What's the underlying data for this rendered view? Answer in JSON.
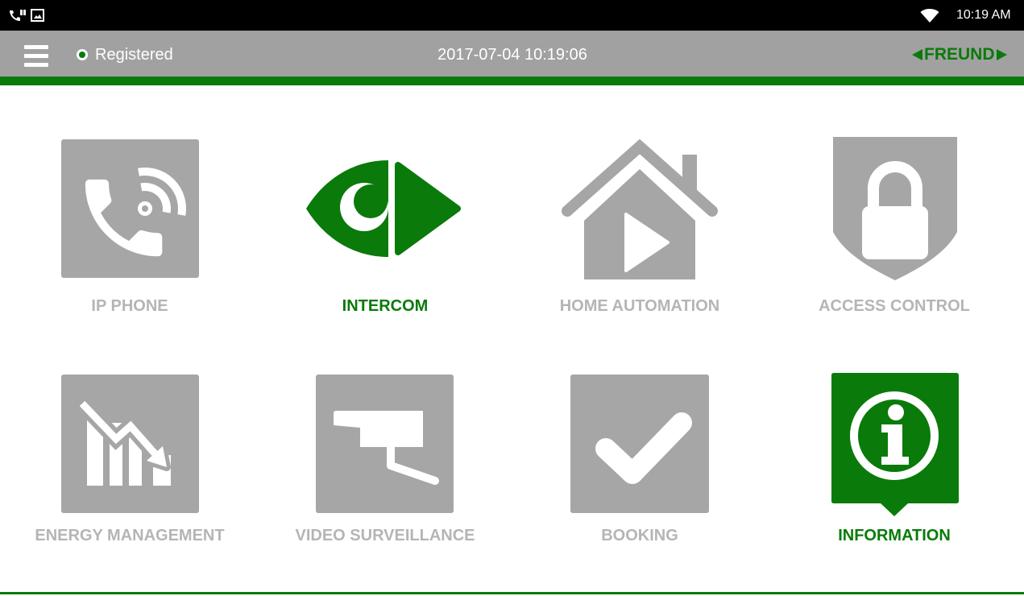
{
  "status_bar": {
    "left_icons": [
      "phone-notification-icon",
      "image-notification-icon"
    ],
    "right_icons": [
      "wifi-icon"
    ],
    "time": "10:19 AM"
  },
  "header": {
    "menu_icon": "hamburger-menu-icon",
    "registration_indicator_icon": "registered-status-dot-icon",
    "registration_status": "Registered",
    "datetime": "2017-07-04 10:19:06",
    "brand": "FREUND",
    "brand_icons": [
      "brand-left-triangle-icon",
      "brand-right-triangle-icon"
    ]
  },
  "tiles": [
    {
      "label": "IP PHONE",
      "icon": "phone-signal-icon",
      "highlighted": false
    },
    {
      "label": "INTERCOM",
      "icon": "eye-play-icon",
      "highlighted": true
    },
    {
      "label": "HOME AUTOMATION",
      "icon": "house-play-icon",
      "highlighted": false
    },
    {
      "label": "ACCESS CONTROL",
      "icon": "shield-lock-icon",
      "highlighted": false
    },
    {
      "label": "ENERGY MANAGEMENT",
      "icon": "declining-chart-icon",
      "highlighted": false
    },
    {
      "label": "VIDEO SURVEILLANCE",
      "icon": "security-camera-icon",
      "highlighted": false
    },
    {
      "label": "BOOKING",
      "icon": "checkmark-icon",
      "highlighted": false
    },
    {
      "label": "INFORMATION",
      "icon": "info-icon",
      "highlighted": true
    }
  ],
  "colors": {
    "accent": "#0a7a0a",
    "tile_gray": "#a6a6a6",
    "label_gray": "#b5b5b5",
    "header_gray": "#a1a1a1",
    "status_bar": "#000000",
    "background": "#ffffff"
  }
}
